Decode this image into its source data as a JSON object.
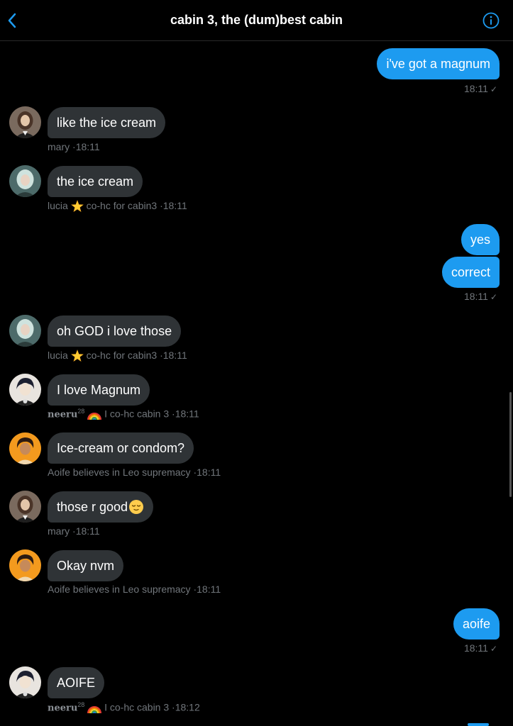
{
  "header": {
    "title": "cabin 3, the (dum)best cabin",
    "back_icon": "chevron-left-icon",
    "info_icon": "info-icon"
  },
  "messages": [
    {
      "type": "sent",
      "text": "i've got a magnum"
    },
    {
      "type": "sent_time",
      "time": "18:11",
      "check": "✓"
    },
    {
      "type": "received",
      "text": "like the ice cream",
      "sender": "mary",
      "time": "18:11"
    },
    {
      "type": "received",
      "text": "the ice cream",
      "sender": "lucia",
      "badge": "co-hc for cabin3",
      "time": "18:11"
    },
    {
      "type": "sent",
      "text": "yes"
    },
    {
      "type": "sent",
      "text": "correct"
    },
    {
      "type": "sent_time",
      "time": "18:11",
      "check": "✓"
    },
    {
      "type": "received",
      "text": "oh GOD i love those",
      "sender": "lucia",
      "badge": "co-hc for cabin3",
      "time": "18:11"
    },
    {
      "type": "received",
      "text": "I love Magnum",
      "sender": "neeru",
      "sup": "28",
      "badge": "I co-hc cabin 3",
      "time": "18:11"
    },
    {
      "type": "received",
      "text": "Ice-cream or condom?",
      "sender": "Aoife believes in Leo supremacy",
      "time": "18:11"
    },
    {
      "type": "received",
      "text": "those r good",
      "sender": "mary",
      "time": "18:11"
    },
    {
      "type": "received",
      "text": "Okay nvm",
      "sender": "Aoife believes in Leo supremacy",
      "time": "18:11"
    },
    {
      "type": "sent",
      "text": "aoife"
    },
    {
      "type": "sent_time",
      "time": "18:11",
      "check": "✓"
    },
    {
      "type": "received",
      "text": "AOIFE",
      "sender": "neeru",
      "sup": "28",
      "badge": "I co-hc cabin 3",
      "time": "18:12"
    }
  ],
  "separator": "·",
  "colors": {
    "accent": "#1d9bf0",
    "received_bubble": "#2f3336",
    "meta_text": "#71767b",
    "background": "#000000"
  }
}
